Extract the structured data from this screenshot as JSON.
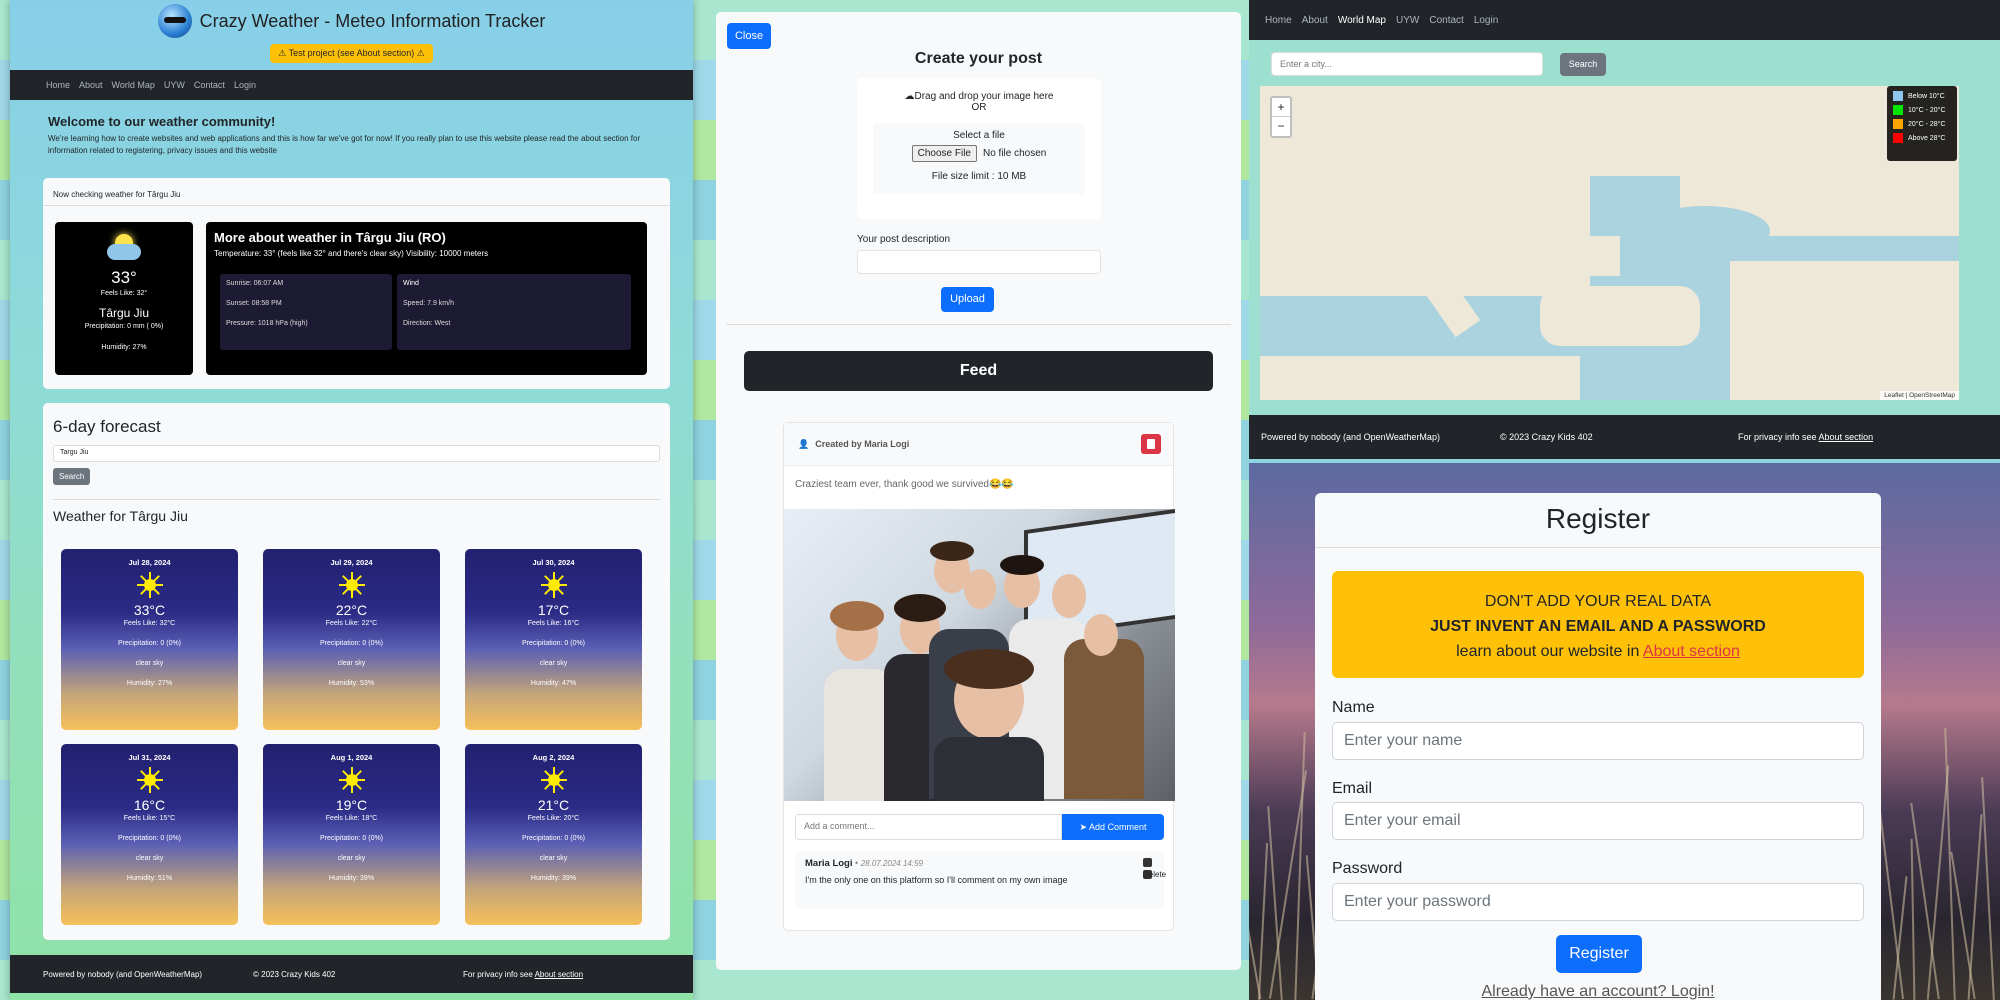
{
  "weather_app": {
    "title": "Crazy Weather - Meteo Information Tracker",
    "test_notice": "⚠ Test project (see About section) ⚠",
    "nav": [
      "Home",
      "About",
      "World Map",
      "UYW",
      "Contact",
      "Login"
    ],
    "welcome_title": "Welcome to our weather community!",
    "welcome_text": "We're learning how to create websites and web applications and this is how far we've got for now! If you really plan to use this website please read the about section for information related to registering, privacy issues and this website",
    "now_checking": "Now checking weather for Târgu Jiu",
    "current": {
      "temp": "33°",
      "feels": "Feels Like: 32°",
      "city": "Târgu Jiu",
      "precip": "Precipitation: 0 mm ( 0%)",
      "humidity": "Humidity: 27%"
    },
    "more_title": "More about weather in Târgu Jiu (RO)",
    "more_line": "Temperature: 33° (feels like 32° and there's clear sky) Visibility: 10000 meters",
    "sun": {
      "sunrise": "Sunrise: 06:07 AM",
      "sunset": "Sunset: 08:58 PM",
      "pressure": "Pressure: 1018 hPa (high)"
    },
    "wind": {
      "title": "Wind",
      "speed": "Speed: 7.9 km/h",
      "direction": "Direction: West"
    },
    "forecast_title": "6-day forecast",
    "forecast_input": "Targu Jiu",
    "search_label": "Search",
    "weather_for": "Weather for Târgu Jiu",
    "days": [
      {
        "date": "Jul 28, 2024",
        "temp": "33°C",
        "feels": "Feels Like: 32°C",
        "precip": "Precipitation: 0 (0%)",
        "desc": "clear sky",
        "hum": "Humidity: 27%"
      },
      {
        "date": "Jul 29, 2024",
        "temp": "22°C",
        "feels": "Feels Like: 22°C",
        "precip": "Precipitation: 0 (0%)",
        "desc": "clear sky",
        "hum": "Humidity: 53%"
      },
      {
        "date": "Jul 30, 2024",
        "temp": "17°C",
        "feels": "Feels Like: 16°C",
        "precip": "Precipitation: 0 (0%)",
        "desc": "clear sky",
        "hum": "Humidity: 47%"
      },
      {
        "date": "Jul 31, 2024",
        "temp": "16°C",
        "feels": "Feels Like: 15°C",
        "precip": "Precipitation: 0 (0%)",
        "desc": "clear sky",
        "hum": "Humidity: 51%"
      },
      {
        "date": "Aug 1, 2024",
        "temp": "19°C",
        "feels": "Feels Like: 18°C",
        "precip": "Precipitation: 0 (0%)",
        "desc": "clear sky",
        "hum": "Humidity: 39%"
      },
      {
        "date": "Aug 2, 2024",
        "temp": "21°C",
        "feels": "Feels Like: 20°C",
        "precip": "Precipitation: 0 (0%)",
        "desc": "clear sky",
        "hum": "Humidity: 39%"
      }
    ],
    "footer": {
      "powered": "Powered by nobody (and OpenWeatherMap)",
      "copyright": "© 2023 Crazy Kids 402",
      "privacy": "For privacy info see",
      "privacy_link": "About section"
    }
  },
  "post_app": {
    "close_label": "Close",
    "create_title": "Create your post",
    "drag_text": "Drag and drop your image here",
    "or_text": "OR",
    "select_file": "Select a file",
    "choose_file": "Choose File",
    "no_file": "No file chosen",
    "size_limit": "File size limit : 10 MB",
    "desc_label": "Your post description",
    "upload_label": "Upload",
    "feed_title": "Feed",
    "post": {
      "created_by": "Created by Maria Logi",
      "text": "Craziest team ever, thank good we survived😂😂",
      "comment_placeholder": "Add a comment...",
      "add_comment": "Add Comment",
      "comment": {
        "author": "Maria Logi",
        "dot": "•",
        "date": "28.07.2024 14:59",
        "text": "I'm the only one on this platform so I'll comment on my own image",
        "delete": "Delete"
      }
    }
  },
  "map_app": {
    "nav": [
      "Home",
      "About",
      "World Map",
      "UYW",
      "Contact",
      "Login"
    ],
    "city_placeholder": "Enter a city...",
    "search_label": "Search",
    "zoom_in": "+",
    "zoom_out": "−",
    "legend": [
      {
        "label": "Below 10°C",
        "color": "#8ec6f0"
      },
      {
        "label": "10°C - 20°C",
        "color": "#00e600"
      },
      {
        "label": "20°C - 28°C",
        "color": "#ffa500"
      },
      {
        "label": "Above 28°C",
        "color": "#ff0000"
      }
    ],
    "attribution": "Leaflet | OpenStreetMap",
    "footer": {
      "powered": "Powered by nobody (and OpenWeatherMap)",
      "copyright": "© 2023 Crazy Kids 402",
      "privacy": "For privacy info see",
      "privacy_link": "About section"
    }
  },
  "register_app": {
    "title": "Register",
    "warn1": "DON'T ADD YOUR REAL DATA",
    "warn2": "JUST INVENT AN EMAIL AND A PASSWORD",
    "warn3": "learn about our website in",
    "warn_link": "About section",
    "name_label": "Name",
    "name_ph": "Enter your name",
    "email_label": "Email",
    "email_ph": "Enter your email",
    "password_label": "Password",
    "password_ph": "Enter your password",
    "register_btn": "Register",
    "login_link": "Already have an account? Login!"
  }
}
